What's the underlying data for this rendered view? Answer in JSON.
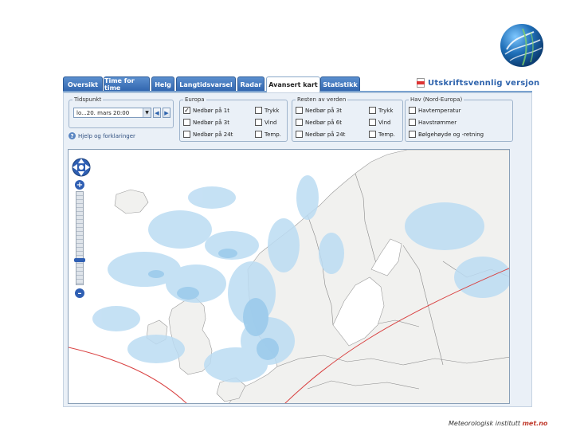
{
  "tabs": [
    {
      "label": "Oversikt",
      "active": false
    },
    {
      "label": "Time for time",
      "active": false
    },
    {
      "label": "Helg",
      "active": false
    },
    {
      "label": "Langtidsvarsel",
      "active": false
    },
    {
      "label": "Radar",
      "active": false
    },
    {
      "label": "Avansert kart",
      "active": true
    },
    {
      "label": "Statistikk",
      "active": false
    }
  ],
  "print": {
    "label": "Utskriftsvennlig versjon",
    "icon": "pdf-icon"
  },
  "controls": {
    "tidspunkt": {
      "legend": "Tidspunkt",
      "value": "lo...20. mars 20:00",
      "help": "Hjelp og forklaringer"
    },
    "europa": {
      "legend": "Europa",
      "left": [
        {
          "label": "Nedbør på 1t",
          "checked": true
        },
        {
          "label": "Nedbør på 3t",
          "checked": false
        },
        {
          "label": "Nedbør på 24t",
          "checked": false
        }
      ],
      "right": [
        {
          "label": "Trykk",
          "checked": false
        },
        {
          "label": "Vind",
          "checked": false
        },
        {
          "label": "Temp.",
          "checked": false
        }
      ]
    },
    "resten": {
      "legend": "Resten av verden",
      "left": [
        {
          "label": "Nedbør på 3t",
          "checked": false
        },
        {
          "label": "Nedbør på 6t",
          "checked": false
        },
        {
          "label": "Nedbør på 24t",
          "checked": false
        }
      ],
      "right": [
        {
          "label": "Trykk",
          "checked": false
        },
        {
          "label": "Vind",
          "checked": false
        },
        {
          "label": "Temp.",
          "checked": false
        }
      ]
    },
    "hav": {
      "legend": "Hav (Nord-Europa)",
      "items": [
        {
          "label": "Havtemperatur",
          "checked": false
        },
        {
          "label": "Havstrømmer",
          "checked": false
        },
        {
          "label": "Bølgehøyde og -retning",
          "checked": false
        }
      ]
    }
  },
  "zoom": {
    "in": "+",
    "out": "–"
  },
  "footer": {
    "institute": "Meteorologisk institutt",
    "link": "met.no"
  },
  "colors": {
    "tab": "#2f64ad",
    "precip": "#bfe0f5",
    "land": "#f2f2f0",
    "sea": "#ffffff",
    "borders": "#8a8a8a",
    "line": "#d94141"
  }
}
